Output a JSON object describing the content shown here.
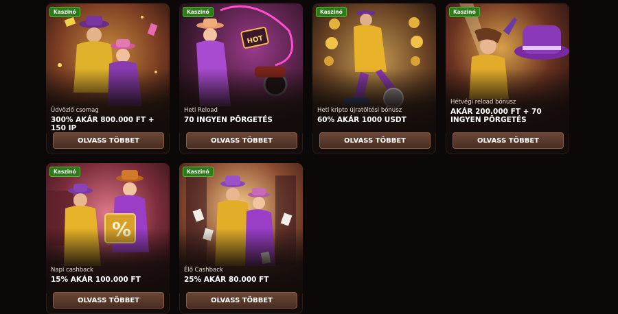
{
  "cards": [
    {
      "badge": "Kaszinó",
      "subtitle": "Üdvözlő csomag",
      "title": "300% AKÁR 800.000 FT + 150 IP",
      "button": "OLVASS TÖBBET"
    },
    {
      "badge": "Kaszinó",
      "subtitle": "Heti Reload",
      "title": "70 INGYEN PÖRGETÉS",
      "button": "OLVASS TÖBBET",
      "sign_text": "HOT"
    },
    {
      "badge": "Kaszinó",
      "subtitle": "Heti kripto újratöltési bónusz",
      "title": "60% AKÁR 1000 USDT",
      "button": "OLVASS TÖBBET"
    },
    {
      "badge": "Kaszinó",
      "subtitle": "Hétvégi reload bónusz",
      "title": "AKÁR 200.000 FT + 70 INGYEN PÖRGETÉS",
      "button": "OLVASS TÖBBET"
    },
    {
      "badge": "Kaszinó",
      "subtitle": "Napi cashback",
      "title": "15% AKÁR 100.000 FT",
      "button": "OLVASS TÖBBET",
      "bag_symbol": "%"
    },
    {
      "badge": "Kaszinó",
      "subtitle": "Élő Cashback",
      "title": "25% AKÁR 80.000 FT",
      "button": "OLVASS TÖBBET"
    }
  ],
  "colors": {
    "badge_bg": "#2f7a1d",
    "button_bg": "#5a3a2c",
    "page_bg": "#0b0807"
  }
}
